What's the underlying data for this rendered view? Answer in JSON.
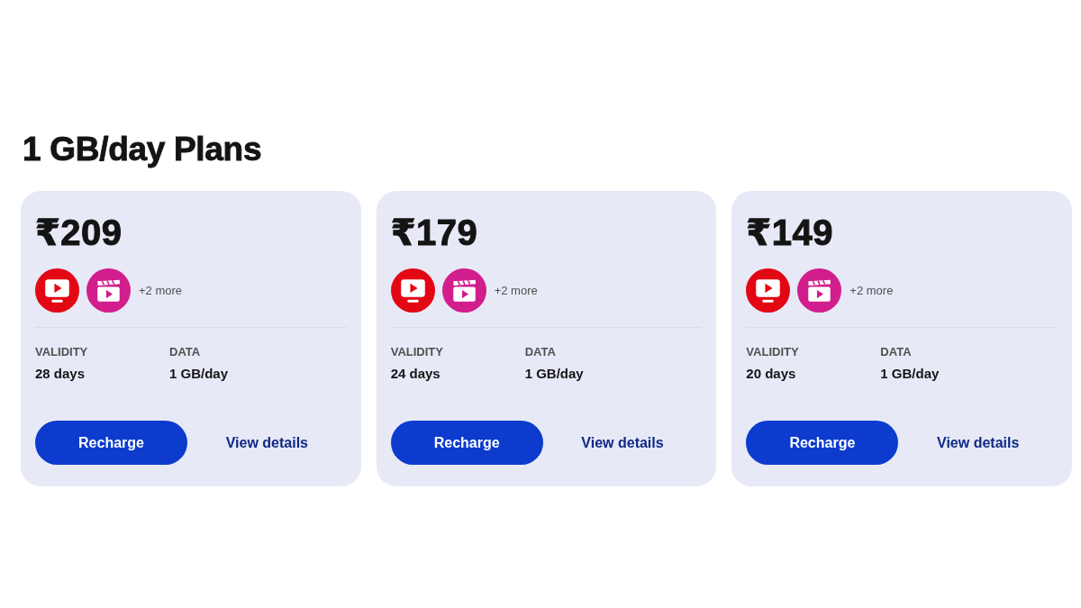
{
  "heading": "1 GB/day Plans",
  "plans": [
    {
      "price": "₹209",
      "more": "+2 more",
      "details": [
        {
          "label": "VALIDITY",
          "value": "28 days"
        },
        {
          "label": "DATA",
          "value": "1 GB/day"
        }
      ],
      "action": "Recharge",
      "link": "View details"
    },
    {
      "price": "₹179",
      "more": "+2 more",
      "details": [
        {
          "label": "VALIDITY",
          "value": "24 days"
        },
        {
          "label": "DATA",
          "value": "1 GB/day"
        }
      ],
      "action": "Recharge",
      "link": "View details"
    },
    {
      "price": "₹149",
      "more": "+2 more",
      "details": [
        {
          "label": "VALIDITY",
          "value": "20 days"
        },
        {
          "label": "DATA",
          "value": "1 GB/day"
        }
      ],
      "action": "Recharge",
      "link": "View details"
    }
  ]
}
